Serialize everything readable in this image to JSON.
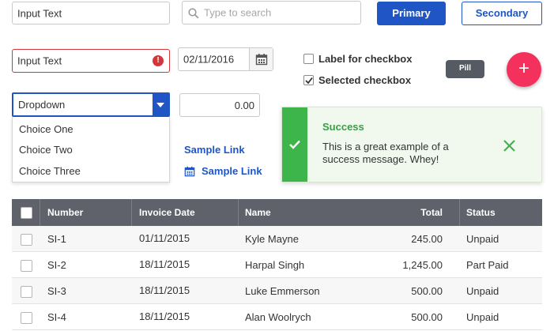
{
  "form": {
    "input_text_value": "Input Text",
    "search_placeholder": "Type to search",
    "error_input_value": "Input Text",
    "date_value": "02/11/2016",
    "number_value": "0.00"
  },
  "buttons": {
    "primary_label": "Primary",
    "secondary_label": "Secondary"
  },
  "checkboxes": {
    "unchecked_label": "Label for checkbox",
    "checked_label": "Selected checkbox"
  },
  "pill": {
    "label": "Pill"
  },
  "fab": {
    "icon": "plus-icon",
    "glyph": "+"
  },
  "dropdown": {
    "selected": "Dropdown",
    "options": [
      "Choice One",
      "Choice Two",
      "Choice Three"
    ]
  },
  "links": {
    "link1": "Sample Link",
    "link2": "Sample Link",
    "link2_icon": "calendar-icon"
  },
  "toast": {
    "title": "Success",
    "message": "This is a great example of a success message. Whey!",
    "icon": "check-icon",
    "close_icon": "close-icon"
  },
  "table": {
    "headers": [
      "Number",
      "Invoice Date",
      "Name",
      "Total",
      "Status"
    ],
    "rows": [
      {
        "number": "SI-1",
        "date": "01/11/2015",
        "name": "Kyle Mayne",
        "total": "245.00",
        "status": "Unpaid"
      },
      {
        "number": "SI-2",
        "date": "18/11/2015",
        "name": "Harpal Singh",
        "total": "1,245.00",
        "status": "Part Paid"
      },
      {
        "number": "SI-3",
        "date": "18/11/2015",
        "name": "Luke Emmerson",
        "total": "500.00",
        "status": "Unpaid"
      },
      {
        "number": "SI-4",
        "date": "18/11/2015",
        "name": "Alan Woolrych",
        "total": "500.00",
        "status": "Unpaid"
      }
    ]
  },
  "colors": {
    "primary": "#1f55c4",
    "error": "#d4363c",
    "success": "#3db54a",
    "fab": "#f4315d",
    "table_header": "#5f626b"
  }
}
